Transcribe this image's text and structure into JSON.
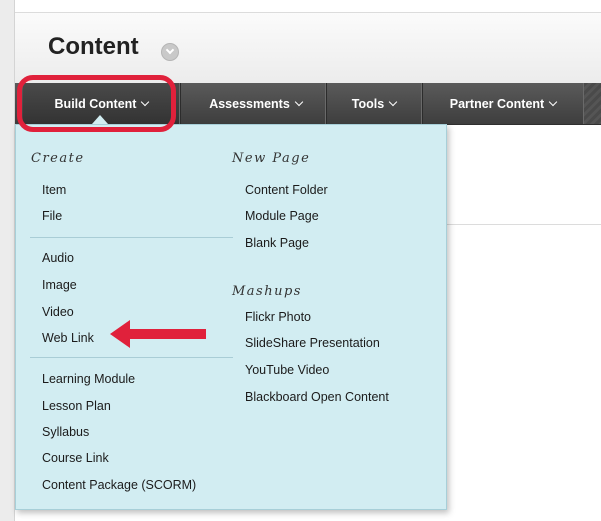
{
  "page": {
    "title": "Content"
  },
  "toolbar": {
    "build_content": "Build Content",
    "assessments": "Assessments",
    "tools": "Tools",
    "partner_content": "Partner Content"
  },
  "menu": {
    "create_heading": "Create",
    "new_page_heading": "New Page",
    "mashups_heading": "Mashups",
    "create_items": [
      "Item",
      "File",
      "Audio",
      "Image",
      "Video",
      "Web Link",
      "Learning Module",
      "Lesson Plan",
      "Syllabus",
      "Course Link",
      "Content Package (SCORM)"
    ],
    "new_page_items": [
      "Content Folder",
      "Module Page",
      "Blank Page"
    ],
    "mashup_items": [
      "Flickr Photo",
      "SlideShare Presentation",
      "YouTube Video",
      "Blackboard Open Content"
    ]
  },
  "colors": {
    "accent_highlight": "#e0213b",
    "menu_background": "#d2edf2",
    "toolbar": "#4a4a4a"
  },
  "icons": {
    "title_badge": "chevron-down-circle-icon",
    "dropdown_chevron": "chevron-down-icon",
    "annotation": "arrow-left-icon"
  }
}
